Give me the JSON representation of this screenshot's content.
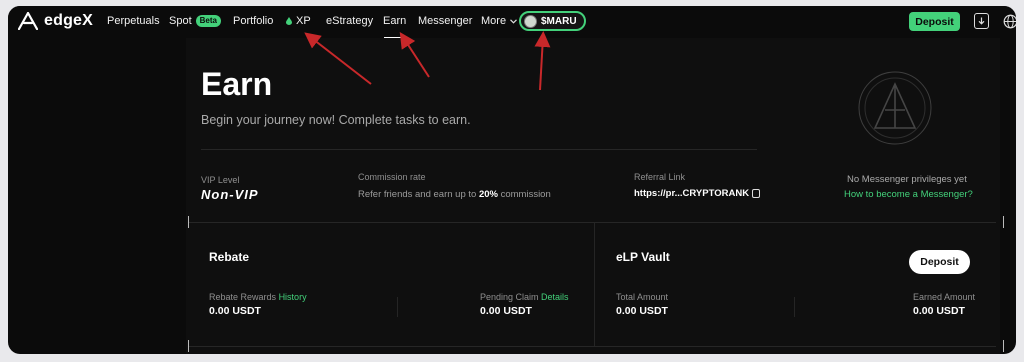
{
  "nav": {
    "logo_text": "edgeX",
    "items": [
      {
        "label": "Perpetuals"
      },
      {
        "label": "Spot",
        "badge": "Beta"
      },
      {
        "label": "Portfolio"
      },
      {
        "label": "XP"
      },
      {
        "label": "eStrategy"
      },
      {
        "label": "Earn",
        "active": true
      },
      {
        "label": "Messenger"
      },
      {
        "label": "More"
      }
    ],
    "maru_label": "$MARU",
    "deposit_label": "Deposit"
  },
  "hero": {
    "title": "Earn",
    "subtitle": "Begin your journey now! Complete tasks to earn."
  },
  "stats": {
    "vip_label": "VIP Level",
    "vip_value": "Non-VIP",
    "commission_label": "Commission rate",
    "commission_text_prefix": "Refer friends and earn up to ",
    "commission_percent": "20%",
    "commission_text_suffix": " commission",
    "referral_label": "Referral Link",
    "referral_value": "https://pr...CRYPTORANK",
    "messenger_status": "No Messenger privileges yet",
    "messenger_link": "How to become a Messenger?"
  },
  "rebate": {
    "title": "Rebate",
    "rewards_label": "Rebate Rewards",
    "rewards_link": "History",
    "rewards_value": "0.00 USDT",
    "pending_label": "Pending Claim",
    "pending_link": "Details",
    "pending_value": "0.00 USDT"
  },
  "vault": {
    "title": "eLP Vault",
    "deposit_label": "Deposit",
    "total_label": "Total Amount",
    "total_value": "0.00 USDT",
    "earned_label": "Earned Amount",
    "earned_value": "0.00 USDT"
  },
  "colors": {
    "accent": "#43d17a",
    "background": "#0b0b0b",
    "annotation": "#c8282a"
  },
  "icons": [
    "edgex-logo-icon",
    "drop-icon",
    "chevron-down-icon",
    "download-icon",
    "globe-icon",
    "copy-icon",
    "edgex-emblem-icon"
  ]
}
